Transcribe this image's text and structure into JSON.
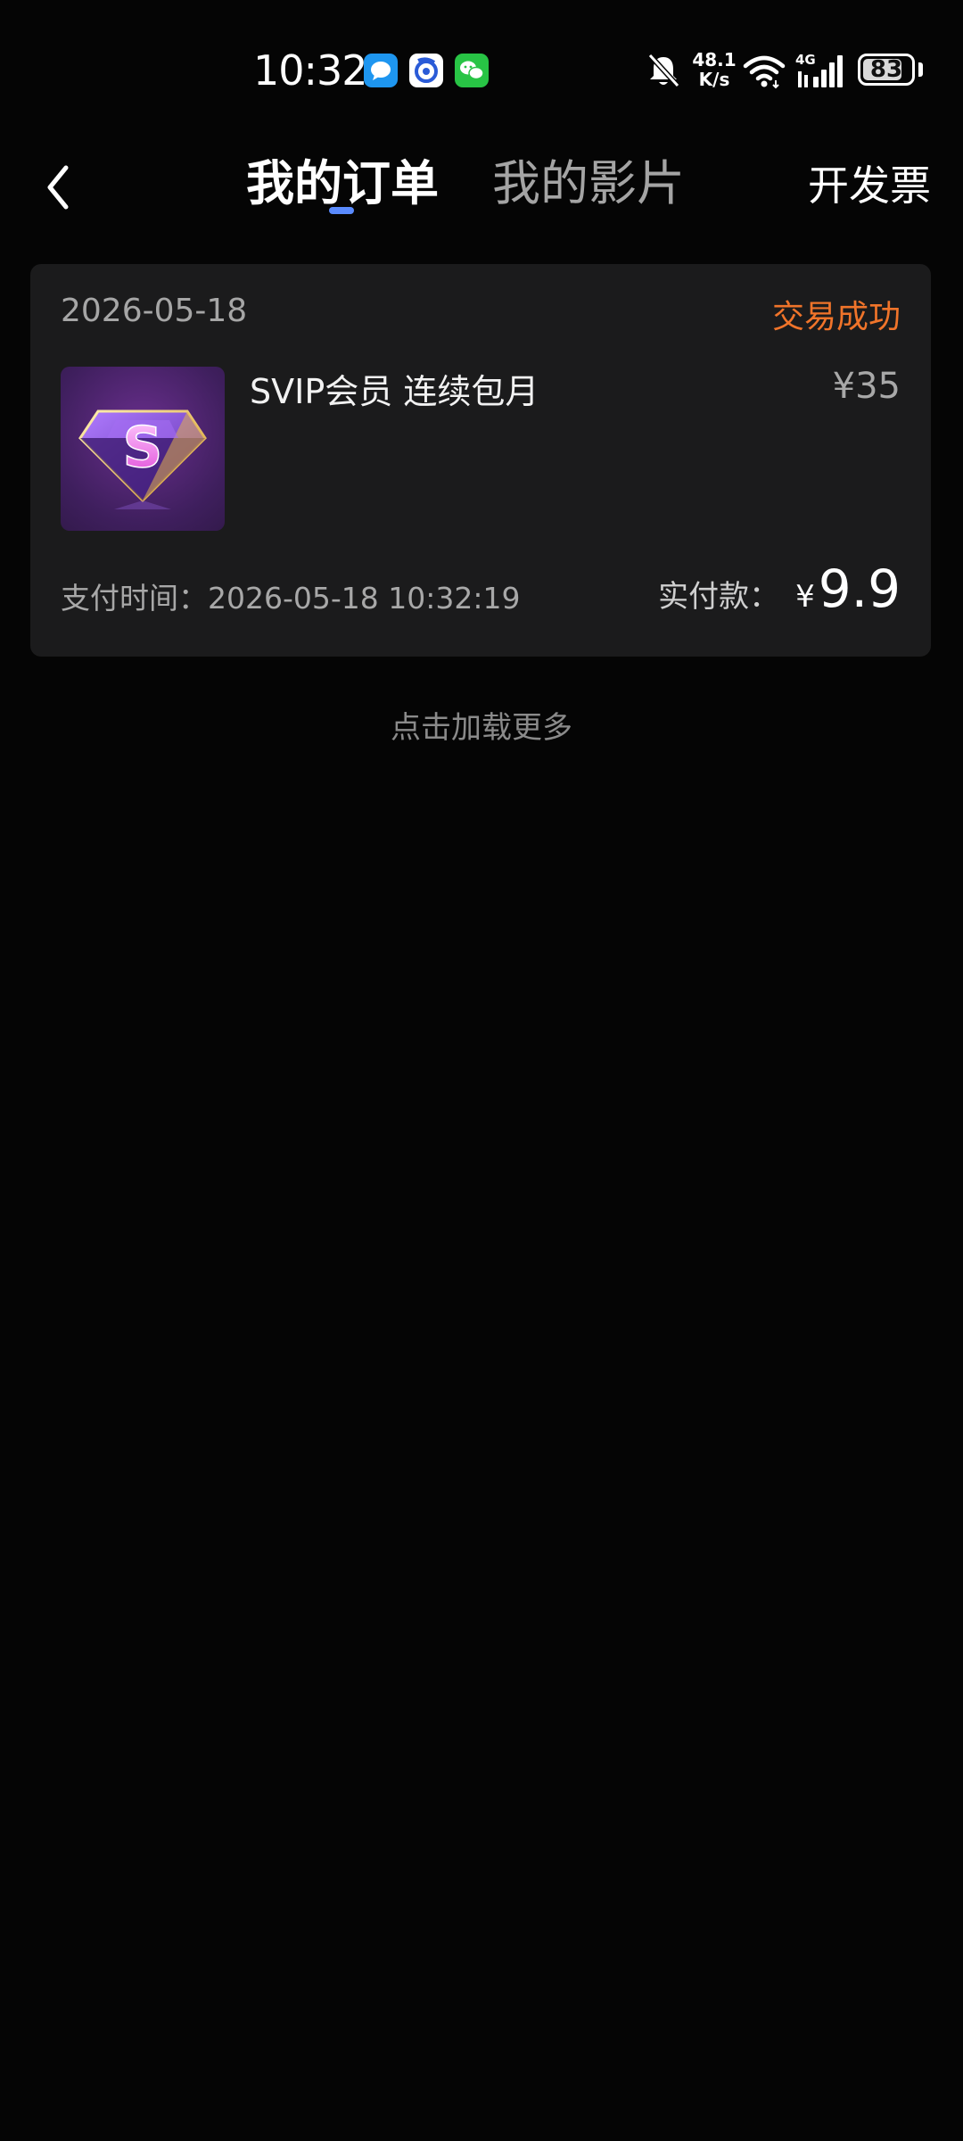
{
  "status_bar": {
    "time": "10:32",
    "net_speed_value": "48.1",
    "net_speed_unit": "K/s",
    "network_type": "4G",
    "battery_level": 83,
    "battery_text": "83",
    "icons": [
      "message-app-icon",
      "baidu-app-icon",
      "wechat-app-icon",
      "bell-muted-icon",
      "wifi-icon",
      "signal-icon",
      "battery-icon"
    ]
  },
  "header": {
    "tabs": [
      {
        "label": "我的订单",
        "active": true
      },
      {
        "label": "我的影片",
        "active": false
      }
    ],
    "invoice_label": "开发票",
    "back_icon": "chevron-left-icon"
  },
  "order": {
    "date": "2026-05-18",
    "status": "交易成功",
    "product_name": "SVIP会员 连续包月",
    "price": "¥35",
    "pay_time": "支付时间：2026-05-18 10:32:19",
    "paid_label": "实付款：",
    "paid_currency": "¥",
    "paid_amount": "9.9",
    "thumb_icon": "svip-diamond-icon",
    "thumb_letter": "S"
  },
  "load_more": "点击加载更多",
  "colors": {
    "background": "#050505",
    "card": "#1b1b1c",
    "status_success": "#f0742a",
    "tab_indicator": "#5a8bff"
  }
}
